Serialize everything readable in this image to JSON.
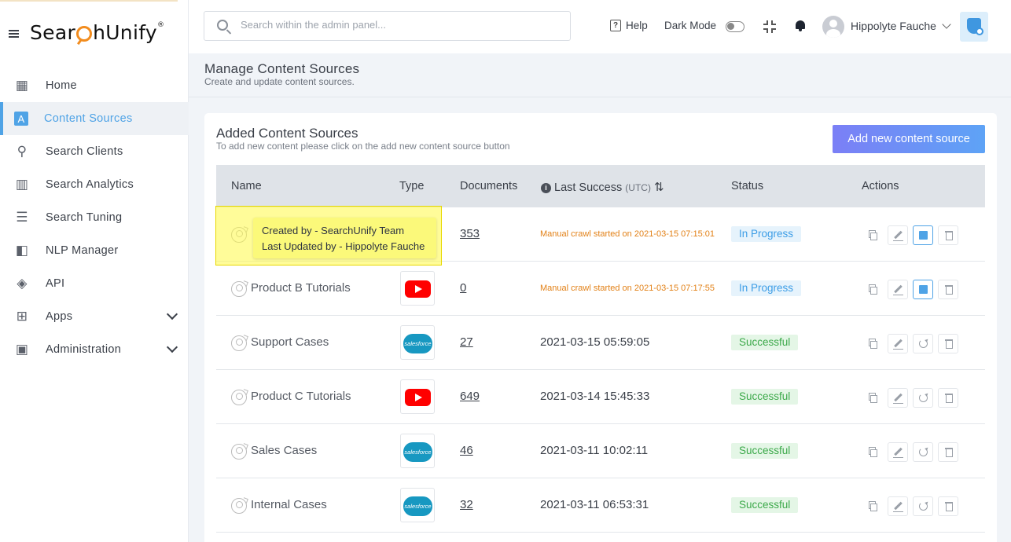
{
  "app": {
    "logo_text_a": "Sear",
    "logo_text_b": "hUnify",
    "logo_reg": "®"
  },
  "sidebar": {
    "items": [
      {
        "label": "Home",
        "icon": "grid-icon"
      },
      {
        "label": "Content Sources",
        "icon": "letter-a-icon",
        "active": true
      },
      {
        "label": "Search Clients",
        "icon": "magnifier-icon"
      },
      {
        "label": "Search Analytics",
        "icon": "bar-chart-icon"
      },
      {
        "label": "Search Tuning",
        "icon": "sliders-icon"
      },
      {
        "label": "NLP Manager",
        "icon": "nlp-icon"
      },
      {
        "label": "API",
        "icon": "code-icon"
      },
      {
        "label": "Apps",
        "icon": "plus-box-icon",
        "expandable": true
      },
      {
        "label": "Administration",
        "icon": "badge-icon",
        "expandable": true
      }
    ]
  },
  "header": {
    "search_placeholder": "Search within the admin panel...",
    "help_label": "Help",
    "help_icon_glyph": "?",
    "dark_mode_label": "Dark Mode",
    "dark_mode_on": false,
    "user_name": "Hippolyte Fauche"
  },
  "page": {
    "title": "Manage Content Sources",
    "subtitle": "Create and update content sources."
  },
  "card": {
    "title": "Added Content Sources",
    "subtitle": "To add new content please click on the add new content source button",
    "add_button_label": "Add new content source",
    "columns": {
      "name": "Name",
      "type": "Type",
      "documents": "Documents",
      "last_success": "Last Success",
      "last_success_unit": "(UTC)",
      "status": "Status",
      "actions": "Actions"
    },
    "rows": [
      {
        "name": "",
        "type": "",
        "documents": "353",
        "last_success": "Manual crawl started on 2021-03-15 07:15:01",
        "in_progress": true,
        "status": "In Progress"
      },
      {
        "name": "Product B Tutorials",
        "type": "youtube",
        "documents": "0",
        "last_success": "Manual crawl started on 2021-03-15 07:17:55",
        "in_progress": true,
        "status": "In Progress"
      },
      {
        "name": "Support Cases",
        "type": "salesforce",
        "documents": "27",
        "last_success": "2021-03-15 05:59:05",
        "in_progress": false,
        "status": "Successful"
      },
      {
        "name": "Product C Tutorials",
        "type": "youtube",
        "documents": "649",
        "last_success": "2021-03-14 15:45:33",
        "in_progress": false,
        "status": "Successful"
      },
      {
        "name": "Sales Cases",
        "type": "salesforce",
        "documents": "46",
        "last_success": "2021-03-11 10:02:11",
        "in_progress": false,
        "status": "Successful"
      },
      {
        "name": "Internal Cases",
        "type": "salesforce",
        "documents": "32",
        "last_success": "2021-03-11 06:53:31",
        "in_progress": false,
        "status": "Successful"
      }
    ]
  },
  "tooltip": {
    "created_by": "Created by - SearchUnify Team",
    "updated_by": "Last Updated by - Hippolyte Fauche"
  },
  "logos": {
    "salesforce_text": "salesforce"
  },
  "colors": {
    "accent": "#4fa3e6",
    "in_progress": "#3c9de6",
    "success": "#3ca94a",
    "crawl_msg": "#e28016",
    "highlight": "#fbf97a"
  }
}
